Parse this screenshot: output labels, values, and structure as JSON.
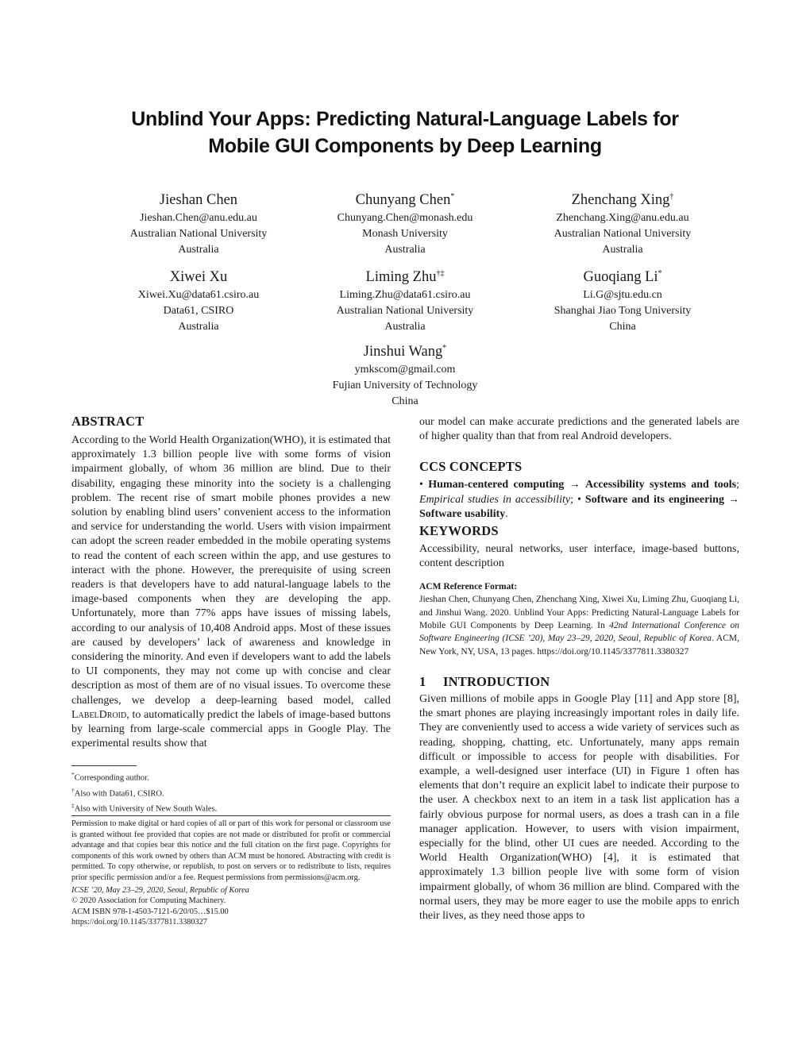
{
  "paper": {
    "title_line1": "Unblind Your Apps: Predicting Natural-Language Labels for",
    "title_line2": "Mobile GUI Components by Deep Learning",
    "authors": [
      {
        "name": "Jieshan Chen",
        "mark": "",
        "email": "Jieshan.Chen@anu.edu.au",
        "affiliation": "Australian National University",
        "country": "Australia"
      },
      {
        "name": "Chunyang Chen",
        "mark": "*",
        "email": "Chunyang.Chen@monash.edu",
        "affiliation": "Monash University",
        "country": "Australia"
      },
      {
        "name": "Zhenchang Xing",
        "mark": "†",
        "email": "Zhenchang.Xing@anu.edu.au",
        "affiliation": "Australian National University",
        "country": "Australia"
      },
      {
        "name": "Xiwei Xu",
        "mark": "",
        "email": "Xiwei.Xu@data61.csiro.au",
        "affiliation": "Data61, CSIRO",
        "country": "Australia"
      },
      {
        "name": "Liming Zhu",
        "mark": "†‡",
        "email": "Liming.Zhu@data61.csiro.au",
        "affiliation": "Australian National University",
        "country": "Australia"
      },
      {
        "name": "Guoqiang Li",
        "mark": "*",
        "email": "Li.G@sjtu.edu.cn",
        "affiliation": "Shanghai Jiao Tong University",
        "country": "China"
      },
      {
        "name": "Jinshui Wang",
        "mark": "*",
        "email": "ymkscom@gmail.com",
        "affiliation": "Fujian University of Technology",
        "country": "China"
      }
    ],
    "abstract": {
      "heading": "ABSTRACT",
      "text_before_name": "According to the World Health Organization(WHO), it is estimated that approximately 1.3 billion people live with some forms of vision impairment globally, of whom 36 million are blind. Due to their disability, engaging these minority into the society is a challenging problem. The recent rise of smart mobile phones provides a new solution by enabling blind users’ convenient access to the information and service for understanding the world. Users with vision impairment can adopt the screen reader embedded in the mobile operating systems to read the content of each screen within the app, and use gestures to interact with the phone. However, the prerequisite of using screen readers is that developers have to add natural-language labels to the image-based components when they are developing the app. Unfortunately, more than 77% apps have issues of missing labels, according to our analysis of 10,408 Android apps. Most of these issues are caused by developers’ lack of awareness and knowledge in considering the minority. And even if developers want to add the labels to UI components, they may not come up with concise and clear description as most of them are of no visual issues. To overcome these challenges, we develop a deep-learning based model, called ",
      "model_name": "LabelDroid",
      "text_after_name": ", to automatically predict the labels of image-based buttons by learning from large-scale commercial apps in Google Play. The experimental results show that",
      "continuation": "our model can make accurate predictions and the generated labels are of higher quality than that from real Android developers."
    },
    "footnotes": [
      {
        "mark": "*",
        "text": "Corresponding author."
      },
      {
        "mark": "†",
        "text": "Also with Data61, CSIRO."
      },
      {
        "mark": "‡",
        "text": "Also with University of New South Wales."
      }
    ],
    "permission": {
      "text": "Permission to make digital or hard copies of all or part of this work for personal or classroom use is granted without fee provided that copies are not made or distributed for profit or commercial advantage and that copies bear this notice and the full citation on the first page. Copyrights for components of this work owned by others than ACM must be honored. Abstracting with credit is permitted. To copy otherwise, or republish, to post on servers or to redistribute to lists, requires prior specific permission and/or a fee. Request permissions from permissions@acm.org.",
      "venue": "ICSE ’20, May 23–29, 2020, Seoul, Republic of Korea",
      "copyright": "© 2020 Association for Computing Machinery.",
      "isbn": "ACM ISBN 978-1-4503-7121-6/20/05…$15.00",
      "doi": "https://doi.org/10.1145/3377811.3380327"
    },
    "ccs": {
      "heading": "CCS CONCEPTS",
      "bullet1_bold_a": "Human-centered computing",
      "arrow": "→",
      "bullet1_bold_b": "Accessibility systems and tools",
      "bullet1_italic": "Empirical studies in accessibility",
      "bullet2_bold_a": "Software and its engineering",
      "bullet2_bold_b": "Software usability"
    },
    "keywords": {
      "heading": "KEYWORDS",
      "text": "Accessibility, neural networks, user interface, image-based buttons, content description"
    },
    "reference_format": {
      "heading": "ACM Reference Format:",
      "text_plain": "Jieshan Chen, Chunyang Chen, Zhenchang Xing, Xiwei Xu, Liming Zhu, Guoqiang Li, and Jinshui Wang. 2020. Unblind Your Apps: Predicting Natural-Language Labels for Mobile GUI Components by Deep Learning. In ",
      "text_italic": "42nd International Conference on Software Engineering (ICSE ’20), May 23–29, 2020, Seoul, Republic of Korea",
      "text_tail": ". ACM, New York, NY, USA, 13 pages. https://doi.org/10.1145/3377811.3380327"
    },
    "introduction": {
      "number": "1",
      "heading": "INTRODUCTION",
      "text": "Given millions of mobile apps in Google Play [11] and App store [8], the smart phones are playing increasingly important roles in daily life. They are conveniently used to access a wide variety of services such as reading, shopping, chatting, etc. Unfortunately, many apps remain difficult or impossible to access for people with disabilities. For example, a well-designed user interface (UI) in Figure 1 often has elements that don’t require an explicit label to indicate their purpose to the user. A checkbox next to an item in a task list application has a fairly obvious purpose for normal users, as does a trash can in a file manager application. However, to users with vision impairment, especially for the blind, other UI cues are needed. According to the World Health Organization(WHO) [4], it is estimated that approximately 1.3 billion people live with some form of vision impairment globally, of whom 36 million are blind. Compared with the normal users, they may be more eager to use the mobile apps to enrich their lives, as they need those apps to"
    }
  }
}
